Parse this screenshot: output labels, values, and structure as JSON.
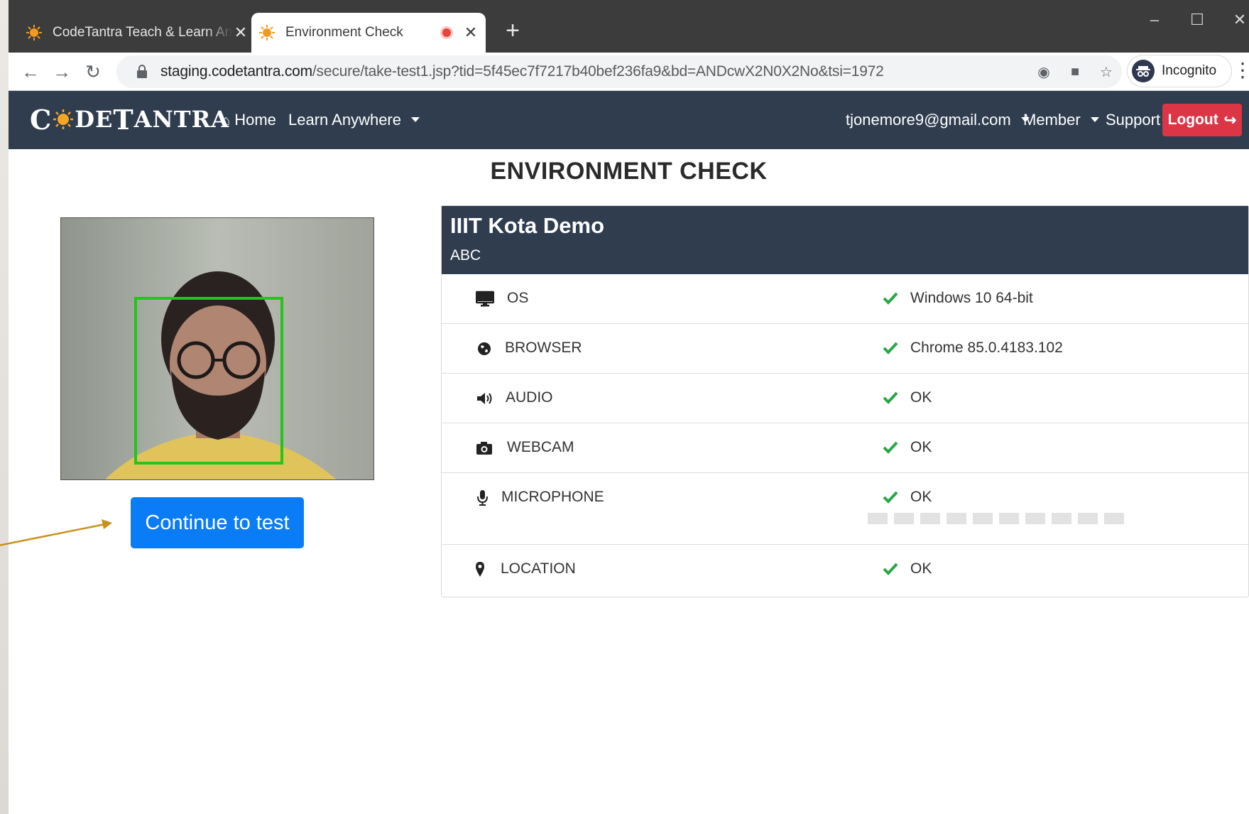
{
  "browser": {
    "tabs": [
      {
        "title": "CodeTantra Teach & Learn Anywh",
        "active": false
      },
      {
        "title": "Environment Check",
        "active": true,
        "recording": true
      }
    ],
    "url_host": "staging.codetantra.com",
    "url_path": "/secure/take-test1.jsp?tid=5f45ec7f7217b40bef236fa9&bd=ANDcwX2N0X2No&tsi=1972",
    "profile_label": "Incognito"
  },
  "navbar": {
    "brand": "CodeTantra",
    "brand_parts": {
      "c": "C",
      "rest1": "DE",
      "t": "T",
      "rest2": "ANTRA"
    },
    "home": "Home",
    "learn_anywhere": "Learn Anywhere",
    "user_email": "tjonemore9@gmail.com",
    "member": "Member",
    "support": "Support",
    "logout": "Logout"
  },
  "page": {
    "title": "ENVIRONMENT CHECK",
    "continue_label": "Continue to test"
  },
  "panel": {
    "title": "IIIT Kota Demo",
    "subtitle": "ABC",
    "rows": [
      {
        "label": "OS",
        "icon": "desktop-icon",
        "value": "Windows 10 64-bit",
        "status": "ok"
      },
      {
        "label": "BROWSER",
        "icon": "globe-icon",
        "value": "Chrome 85.0.4183.102",
        "status": "ok"
      },
      {
        "label": "AUDIO",
        "icon": "speaker-icon",
        "value": "OK",
        "status": "ok"
      },
      {
        "label": "WEBCAM",
        "icon": "camera-icon",
        "value": "OK",
        "status": "ok"
      },
      {
        "label": "MICROPHONE",
        "icon": "microphone-icon",
        "value": "OK",
        "status": "ok",
        "level_segments": 10,
        "level_active": 0
      },
      {
        "label": "LOCATION",
        "icon": "map-marker-icon",
        "value": "OK",
        "status": "ok"
      }
    ]
  },
  "colors": {
    "navbar_bg": "#2f3d4f",
    "logout_bg": "#dc3545",
    "primary_button": "#0a7cf5",
    "check_green": "#28a745",
    "face_box": "#22c51a",
    "annotation_arrow": "#c8911c"
  }
}
